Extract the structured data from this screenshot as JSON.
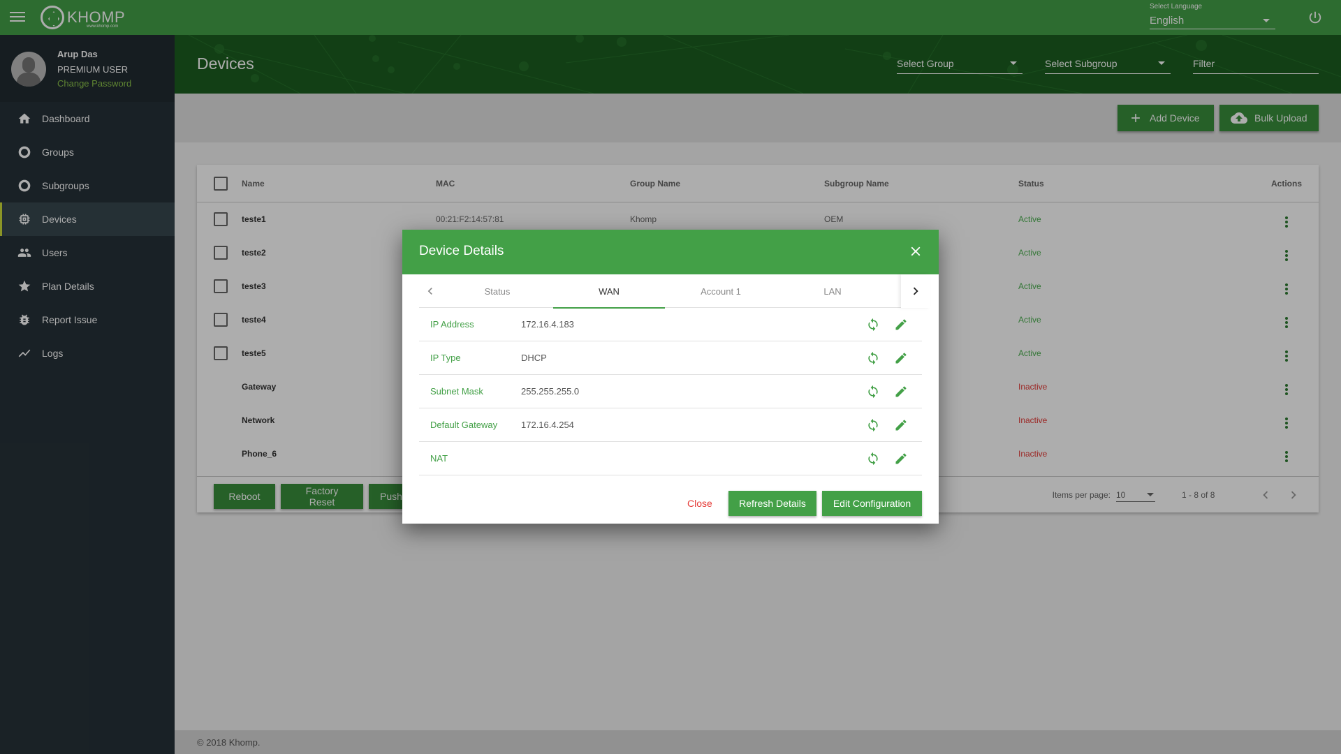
{
  "app": {
    "brand": "KHOMP",
    "brand_sub": "www.khomp.com",
    "language_label": "Select Language",
    "language_value": "English",
    "accent": "#43a047"
  },
  "profile": {
    "name": "Arup Das",
    "role": "PREMIUM USER",
    "change_password": "Change Password"
  },
  "sidebar": {
    "items": [
      {
        "label": "Dashboard",
        "icon": "home-icon"
      },
      {
        "label": "Groups",
        "icon": "circle-icon"
      },
      {
        "label": "Subgroups",
        "icon": "circle-icon"
      },
      {
        "label": "Devices",
        "icon": "chip-icon",
        "active": true
      },
      {
        "label": "Users",
        "icon": "users-icon"
      },
      {
        "label": "Plan Details",
        "icon": "star-icon"
      },
      {
        "label": "Report Issue",
        "icon": "bug-icon"
      },
      {
        "label": "Logs",
        "icon": "trend-icon"
      }
    ]
  },
  "page": {
    "title": "Devices",
    "select_group": "Select Group",
    "select_subgroup": "Select Subgroup",
    "filter_placeholder": "Filter",
    "add_device": "Add Device",
    "bulk_upload": "Bulk Upload"
  },
  "table": {
    "headers": [
      "Name",
      "MAC",
      "Group Name",
      "Subgroup Name",
      "Status",
      "Actions"
    ],
    "rows": [
      {
        "name": "teste1",
        "mac": "00:21:F2:14:57:81",
        "group": "Khomp",
        "subgroup": "OEM",
        "status": "Active",
        "checkbox": true
      },
      {
        "name": "teste2",
        "mac": "",
        "group": "",
        "subgroup": "",
        "status": "Active",
        "checkbox": true
      },
      {
        "name": "teste3",
        "mac": "",
        "group": "",
        "subgroup": "",
        "status": "Active",
        "checkbox": true
      },
      {
        "name": "teste4",
        "mac": "",
        "group": "",
        "subgroup": "",
        "status": "Active",
        "checkbox": true
      },
      {
        "name": "teste5",
        "mac": "",
        "group": "",
        "subgroup": "",
        "status": "Active",
        "checkbox": true
      },
      {
        "name": "Gateway",
        "mac": "",
        "group": "",
        "subgroup": "",
        "status": "Inactive",
        "checkbox": false
      },
      {
        "name": "Network",
        "mac": "",
        "group": "",
        "subgroup": "",
        "status": "Inactive",
        "checkbox": false
      },
      {
        "name": "Phone_6",
        "mac": "",
        "group": "",
        "subgroup": "",
        "status": "Inactive",
        "checkbox": false
      }
    ],
    "footer_buttons": [
      "Reboot",
      "Factory Reset",
      "Push"
    ],
    "items_per_page_label": "Items per page:",
    "items_per_page": "10",
    "range": "1 - 8 of 8"
  },
  "footer": {
    "copyright": "© 2018 Khomp."
  },
  "modal": {
    "title": "Device Details",
    "tabs": [
      {
        "label": "Status"
      },
      {
        "label": "WAN",
        "active": true
      },
      {
        "label": "Account 1"
      },
      {
        "label": "LAN"
      }
    ],
    "rows": [
      {
        "label": "IP Address",
        "value": "172.16.4.183"
      },
      {
        "label": "IP Type",
        "value": "DHCP"
      },
      {
        "label": "Subnet Mask",
        "value": "255.255.255.0"
      },
      {
        "label": "Default Gateway",
        "value": "172.16.4.254"
      },
      {
        "label": "NAT",
        "value": ""
      }
    ],
    "close": "Close",
    "refresh": "Refresh Details",
    "edit": "Edit Configuration"
  }
}
